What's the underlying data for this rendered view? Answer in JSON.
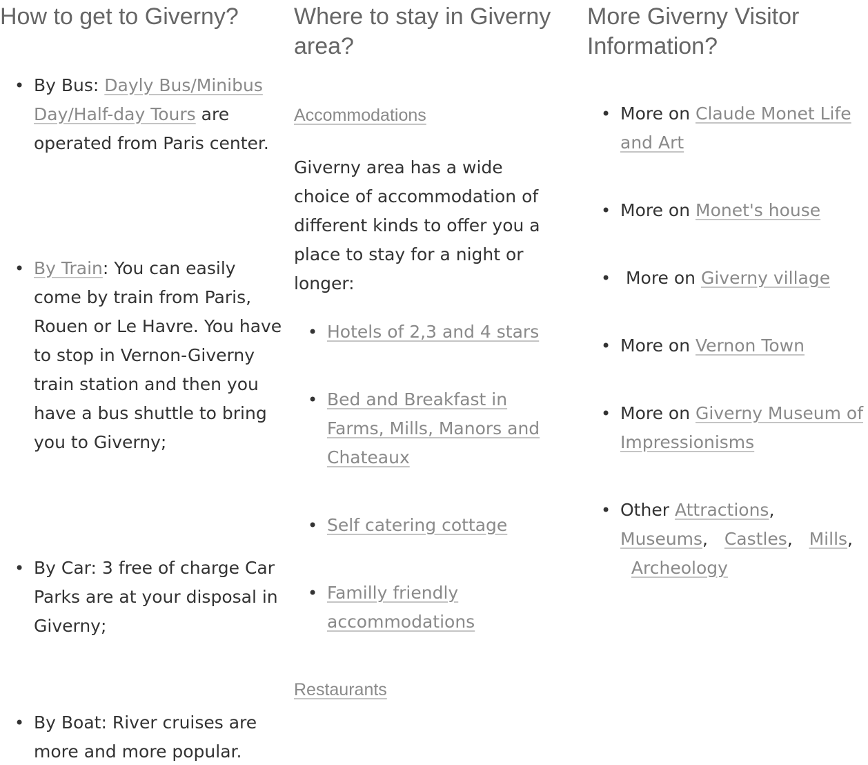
{
  "column1": {
    "heading": "How to get to Giverny?",
    "bus": {
      "prefix": "By Bus: ",
      "link": "Dayly Bus/Minibus Day/Half-day Tours",
      "suffix": " are operated from Paris center."
    },
    "train": {
      "link": "By Train",
      "suffix": ": You can easily come by train from Paris, Rouen or Le Havre. You have to stop in Vernon-Giverny train station and then you have a bus shuttle to bring you to Giverny;"
    },
    "car": {
      "text": "By Car: 3 free of charge Car Parks are at your disposal in Giverny;"
    },
    "boat": {
      "text": "By Boat: River cruises are more and more popular."
    }
  },
  "column2": {
    "heading": "Where to stay in Giverny area?",
    "accommodations_link": "Accommodations",
    "intro": "Giverny area has a wide choice of accommodation of different kinds to offer you a place to stay for a night or longer:",
    "items": [
      "Hotels of 2,3 and 4 stars",
      "Bed and Breakfast in Farms, Mills, Manors and Chateaux",
      "Self catering cottage",
      "Familly friendly accommodations"
    ],
    "restaurants_link": "Restaurants"
  },
  "column3": {
    "heading": "More Giverny Visitor Information?",
    "more_on": "More on ",
    "items": [
      "Claude Monet Life and Art",
      "Monet's house",
      "Giverny village",
      "Vernon Town",
      "Giverny Museum of Impressionisms"
    ],
    "other": {
      "prefix": "Other ",
      "links": [
        "Attractions",
        "Museums",
        "Castles",
        "Mills",
        "Archeology"
      ],
      "separator": ","
    }
  },
  "bullet": "•",
  "colors": {
    "heading": "#666666",
    "text": "#333333",
    "link": "#8a8a8a"
  }
}
